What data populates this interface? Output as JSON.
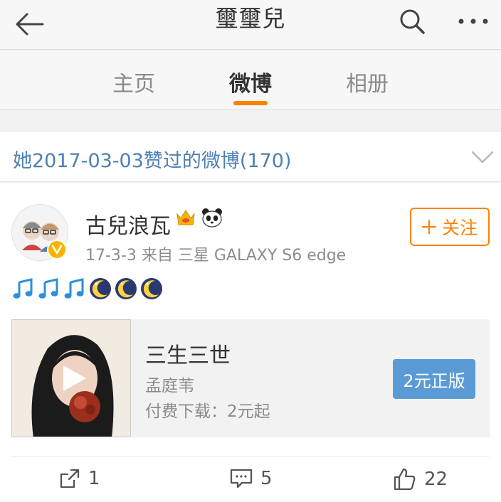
{
  "header": {
    "title": "璽璽兒",
    "back_icon": "arrow-left-icon",
    "search_icon": "search-icon",
    "more_icon": "more-dots-icon"
  },
  "tabs": [
    {
      "label": "主页",
      "active": false
    },
    {
      "label": "微博",
      "active": true
    },
    {
      "label": "相册",
      "active": false
    }
  ],
  "accent": "#ff8200",
  "section": {
    "title": "她2017-03-03赞过的微博(170)",
    "chevron_icon": "chevron-down-icon"
  },
  "post": {
    "username": "古兒浪瓦",
    "meta": "17-3-3  来自 三星 GALAXY S6 edge",
    "follow_label": "关注",
    "follow_icon": "plus-icon",
    "badges": [
      "crown-vip-icon",
      "panda-icon"
    ],
    "emojis": [
      "music-note-icon",
      "music-note-icon",
      "music-note-icon",
      "moon-icon",
      "moon-icon",
      "moon-icon"
    ],
    "music_card": {
      "title": "三生三世",
      "artist": "孟庭苇",
      "price": "付费下载：2元起",
      "buy_label": "2元正版",
      "buy_color": "#5b9bd5"
    },
    "actions": {
      "repost_count": "1",
      "comment_count": "5",
      "like_count": "22"
    }
  }
}
